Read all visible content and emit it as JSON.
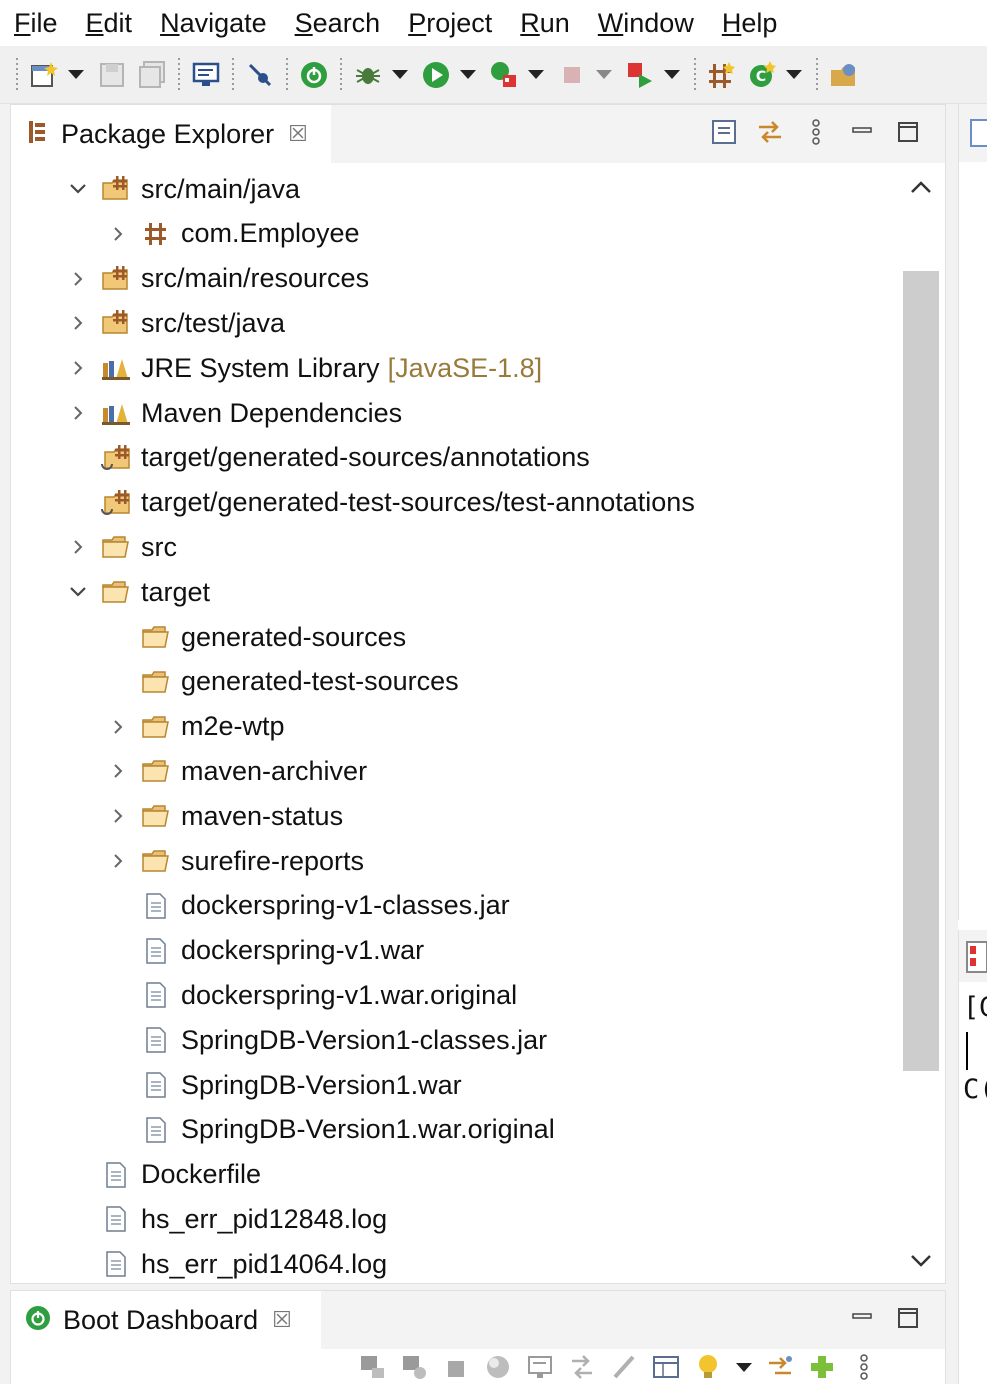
{
  "menu": [
    {
      "mnemonic": "F",
      "rest": "ile"
    },
    {
      "mnemonic": "E",
      "rest": "dit"
    },
    {
      "mnemonic": "N",
      "rest": "avigate"
    },
    {
      "mnemonic": "S",
      "rest": "earch"
    },
    {
      "mnemonic": "P",
      "rest": "roject"
    },
    {
      "mnemonic": "R",
      "rest": "un"
    },
    {
      "mnemonic": "W",
      "rest": "indow"
    },
    {
      "mnemonic": "H",
      "rest": "elp"
    }
  ],
  "explorer": {
    "title": "Package Explorer",
    "close_glyph": "☒",
    "items": [
      {
        "label": "src/main/java",
        "decor": "",
        "depth": 1,
        "expand": "open",
        "icon": "source-folder-icon"
      },
      {
        "label": "com.Employee",
        "decor": "",
        "depth": 2,
        "expand": "closed",
        "icon": "package-icon"
      },
      {
        "label": "src/main/resources",
        "decor": "",
        "depth": 1,
        "expand": "closed",
        "icon": "source-folder-icon"
      },
      {
        "label": "src/test/java",
        "decor": "",
        "depth": 1,
        "expand": "closed",
        "icon": "source-folder-icon"
      },
      {
        "label": "JRE System Library",
        "decor": "[JavaSE-1.8]",
        "depth": 1,
        "expand": "closed",
        "icon": "library-icon"
      },
      {
        "label": "Maven Dependencies",
        "decor": "",
        "depth": 1,
        "expand": "closed",
        "icon": "library-icon"
      },
      {
        "label": "target/generated-sources/annotations",
        "decor": "",
        "depth": 1,
        "expand": "none",
        "icon": "generated-source-folder-icon"
      },
      {
        "label": "target/generated-test-sources/test-annotations",
        "decor": "",
        "depth": 1,
        "expand": "none",
        "icon": "generated-source-folder-icon"
      },
      {
        "label": "src",
        "decor": "",
        "depth": 1,
        "expand": "closed",
        "icon": "folder-icon"
      },
      {
        "label": "target",
        "decor": "",
        "depth": 1,
        "expand": "open",
        "icon": "folder-icon"
      },
      {
        "label": "generated-sources",
        "decor": "",
        "depth": 2,
        "expand": "none",
        "icon": "folder-icon"
      },
      {
        "label": "generated-test-sources",
        "decor": "",
        "depth": 2,
        "expand": "none",
        "icon": "folder-icon"
      },
      {
        "label": "m2e-wtp",
        "decor": "",
        "depth": 2,
        "expand": "closed",
        "icon": "folder-icon"
      },
      {
        "label": "maven-archiver",
        "decor": "",
        "depth": 2,
        "expand": "closed",
        "icon": "folder-icon"
      },
      {
        "label": "maven-status",
        "decor": "",
        "depth": 2,
        "expand": "closed",
        "icon": "folder-icon"
      },
      {
        "label": "surefire-reports",
        "decor": "",
        "depth": 2,
        "expand": "closed",
        "icon": "folder-icon"
      },
      {
        "label": "dockerspring-v1-classes.jar",
        "decor": "",
        "depth": 2,
        "expand": "none",
        "icon": "file-icon"
      },
      {
        "label": "dockerspring-v1.war",
        "decor": "",
        "depth": 2,
        "expand": "none",
        "icon": "file-icon"
      },
      {
        "label": "dockerspring-v1.war.original",
        "decor": "",
        "depth": 2,
        "expand": "none",
        "icon": "file-icon"
      },
      {
        "label": "SpringDB-Version1-classes.jar",
        "decor": "",
        "depth": 2,
        "expand": "none",
        "icon": "file-icon"
      },
      {
        "label": "SpringDB-Version1.war",
        "decor": "",
        "depth": 2,
        "expand": "none",
        "icon": "file-icon"
      },
      {
        "label": "SpringDB-Version1.war.original",
        "decor": "",
        "depth": 2,
        "expand": "none",
        "icon": "file-icon"
      },
      {
        "label": "Dockerfile",
        "decor": "",
        "depth": 1,
        "expand": "none",
        "icon": "file-icon"
      },
      {
        "label": "hs_err_pid12848.log",
        "decor": "",
        "depth": 1,
        "expand": "none",
        "icon": "file-icon"
      },
      {
        "label": "hs_err_pid14064.log",
        "decor": "",
        "depth": 1,
        "expand": "none",
        "icon": "file-icon"
      }
    ]
  },
  "boot": {
    "title": "Boot Dashboard",
    "close_glyph": "☒"
  },
  "right_panel": {
    "line1": "[G",
    "line2": "C("
  },
  "colors": {
    "accent_green": "#2e9e3e",
    "folder_tan": "#d9a84a",
    "package_brown": "#9c5a2a",
    "decor_text": "#9a7a3a"
  }
}
